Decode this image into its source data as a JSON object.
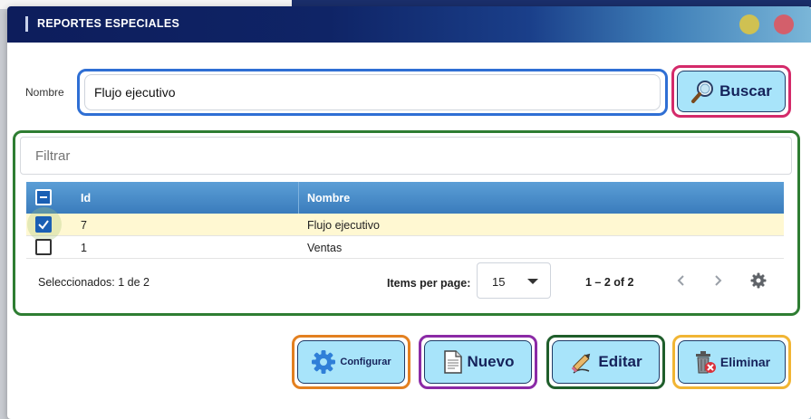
{
  "dialog": {
    "title": "REPORTES ESPECIALES"
  },
  "search": {
    "label": "Nombre",
    "value": "Flujo ejecutivo",
    "button": "Buscar"
  },
  "grid": {
    "filter_placeholder": "Filtrar",
    "columns": [
      "Id",
      "Nombre"
    ],
    "rows": [
      {
        "id": "7",
        "nombre": "Flujo ejecutivo",
        "checked": true
      },
      {
        "id": "1",
        "nombre": "Ventas",
        "checked": false
      }
    ],
    "selected_text": "Seleccionados: 1 de 2",
    "items_per_page_label": "Items per page:",
    "items_per_page": "15",
    "range": "1 – 2 of 2"
  },
  "actions": {
    "configurar": "Configurar",
    "nuevo": "Nuevo",
    "editar": "Editar",
    "eliminar": "Eliminar"
  },
  "colors": {
    "title_bar": "#0f2466",
    "button_fill": "#a8e4fa",
    "buscar_frame": "#d42a6a",
    "grid_frame": "#2e7d32",
    "configurar_frame": "#e38020",
    "nuevo_frame": "#8b2aa6",
    "editar_frame": "#1f5e2b",
    "eliminar_frame": "#f1b534"
  },
  "icons": [
    "search-magnifier-icon",
    "gear-icon",
    "document-icon",
    "edit-pencil-icon",
    "trash-icon",
    "chevron-left-icon",
    "chevron-right-icon",
    "settings-gear-icon"
  ]
}
